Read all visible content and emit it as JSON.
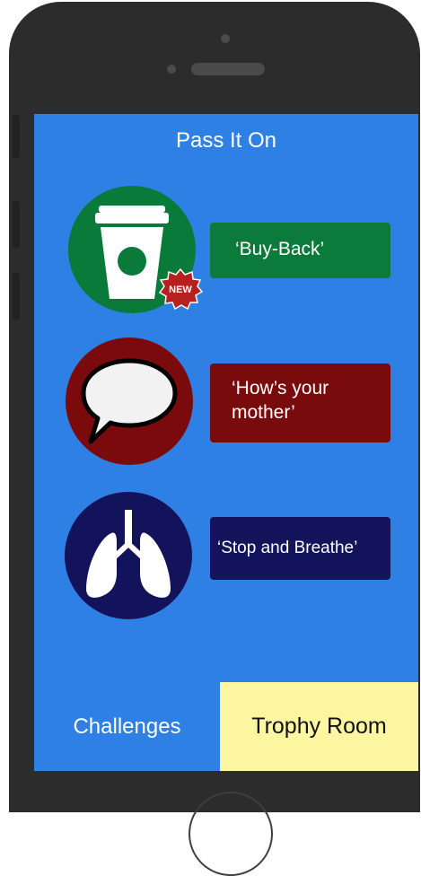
{
  "app": {
    "title": "Pass It On"
  },
  "challenges": [
    {
      "icon": "coffee-cup-icon",
      "label": "‘Buy-Back’",
      "badge": "NEW",
      "circle_color": "#0a7a3a",
      "button_color": "#0c7a3a"
    },
    {
      "icon": "speech-bubble-icon",
      "label": "‘How’s your mother’",
      "circle_color": "#7a0a0c",
      "button_color": "#7a0b0d"
    },
    {
      "icon": "lungs-icon",
      "label": "‘Stop and Breathe’",
      "circle_color": "#12135a",
      "button_color": "#13145b"
    }
  ],
  "tabs": {
    "challenges": "Challenges",
    "trophy_room": "Trophy Room"
  },
  "colors": {
    "screen_bg": "#2f80e4",
    "trophy_bg": "#fdf6a0",
    "phone_body": "#2c2c2c"
  }
}
